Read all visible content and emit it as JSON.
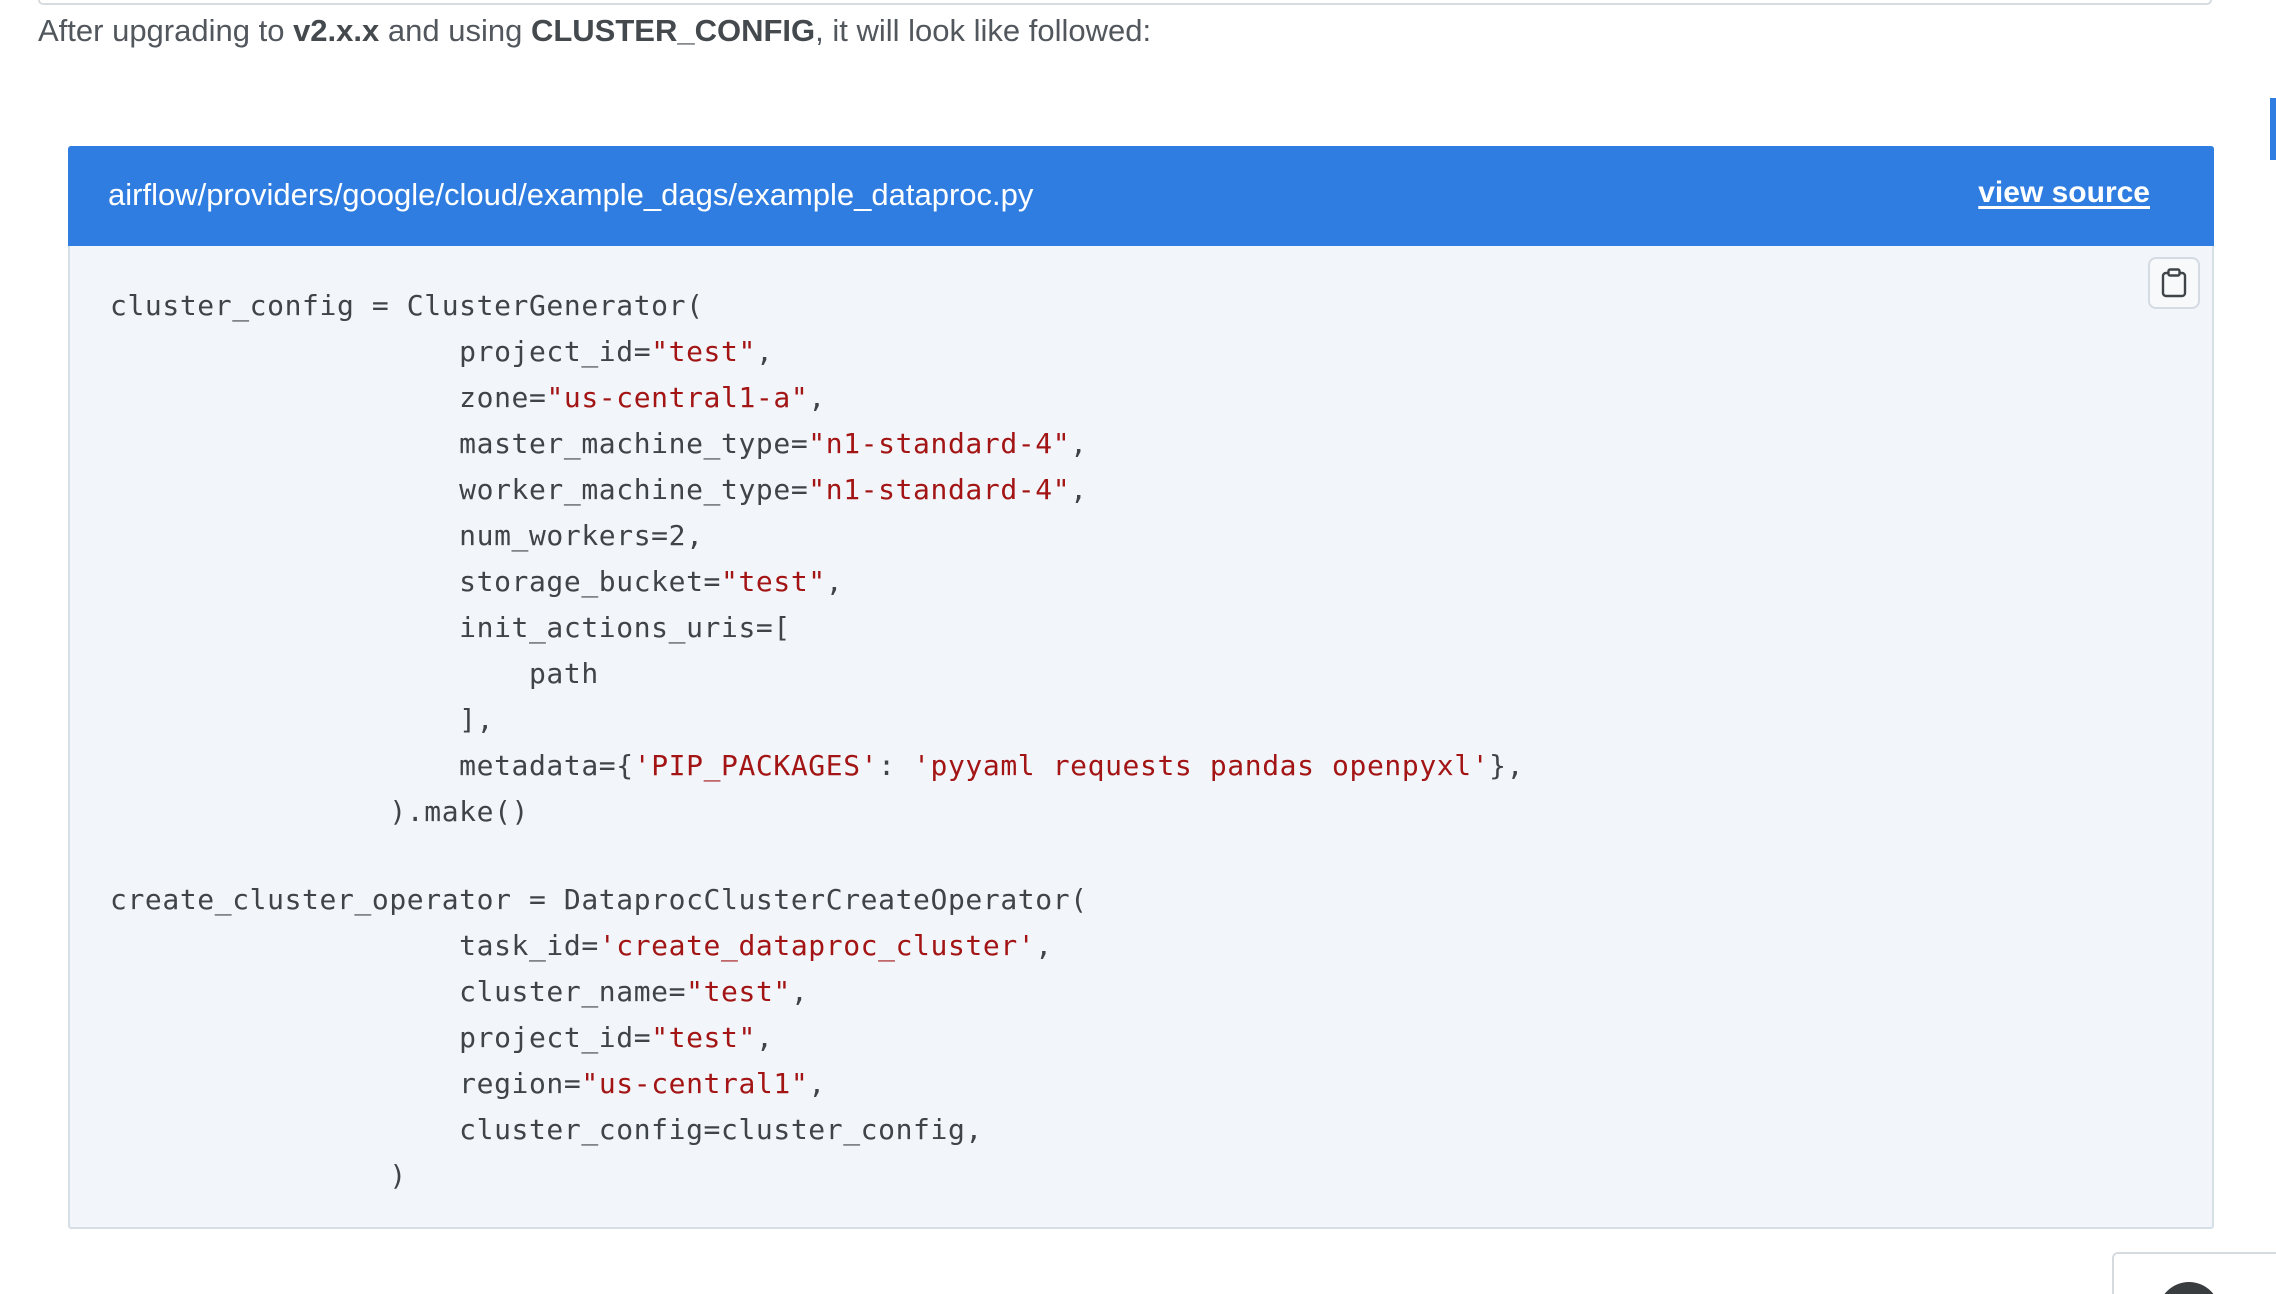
{
  "intro": {
    "text_before": "After upgrading to ",
    "version": "v2.x.x",
    "text_middle": " and using ",
    "config_name": "CLUSTER_CONFIG",
    "text_after": ", it will look like followed:"
  },
  "code_block": {
    "file_path": "airflow/providers/google/cloud/example_dags/example_dataproc.py",
    "view_source_label": "view source",
    "copy_icon": "clipboard-icon",
    "header_color": "#2f7de1",
    "string_color": "#a31515",
    "lines": [
      [
        {
          "t": "cluster_config = ClusterGenerator("
        }
      ],
      [
        {
          "t": "                    project_id="
        },
        {
          "t": "\"test\"",
          "s": true
        },
        {
          "t": ","
        }
      ],
      [
        {
          "t": "                    zone="
        },
        {
          "t": "\"us-central1-a\"",
          "s": true
        },
        {
          "t": ","
        }
      ],
      [
        {
          "t": "                    master_machine_type="
        },
        {
          "t": "\"n1-standard-4\"",
          "s": true
        },
        {
          "t": ","
        }
      ],
      [
        {
          "t": "                    worker_machine_type="
        },
        {
          "t": "\"n1-standard-4\"",
          "s": true
        },
        {
          "t": ","
        }
      ],
      [
        {
          "t": "                    num_workers=2,"
        }
      ],
      [
        {
          "t": "                    storage_bucket="
        },
        {
          "t": "\"test\"",
          "s": true
        },
        {
          "t": ","
        }
      ],
      [
        {
          "t": "                    init_actions_uris=["
        }
      ],
      [
        {
          "t": "                        path"
        }
      ],
      [
        {
          "t": "                    ],"
        }
      ],
      [
        {
          "t": "                    metadata={"
        },
        {
          "t": "'PIP_PACKAGES'",
          "s": true
        },
        {
          "t": ": "
        },
        {
          "t": "'pyyaml requests pandas openpyxl'",
          "s": true
        },
        {
          "t": "},"
        }
      ],
      [
        {
          "t": "                ).make()"
        }
      ],
      [],
      [
        {
          "t": "create_cluster_operator = DataprocClusterCreateOperator("
        }
      ],
      [
        {
          "t": "                    task_id="
        },
        {
          "t": "'create_dataproc_cluster'",
          "s": true
        },
        {
          "t": ","
        }
      ],
      [
        {
          "t": "                    cluster_name="
        },
        {
          "t": "\"test\"",
          "s": true
        },
        {
          "t": ","
        }
      ],
      [
        {
          "t": "                    project_id="
        },
        {
          "t": "\"test\"",
          "s": true
        },
        {
          "t": ","
        }
      ],
      [
        {
          "t": "                    region="
        },
        {
          "t": "\"us-central1\"",
          "s": true
        },
        {
          "t": ","
        }
      ],
      [
        {
          "t": "                    cluster_config=cluster_config,"
        }
      ],
      [
        {
          "t": "                )"
        }
      ]
    ]
  }
}
